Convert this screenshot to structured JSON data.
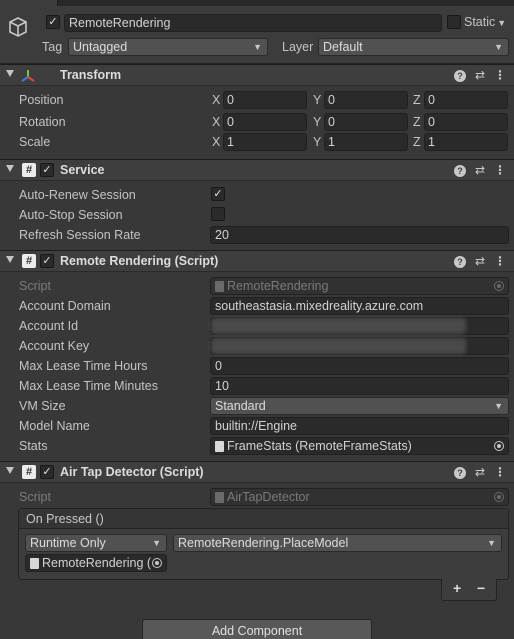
{
  "gameobject": {
    "name": "RemoteRendering",
    "static_label": "Static",
    "tag_label": "Tag",
    "tag_value": "Untagged",
    "layer_label": "Layer",
    "layer_value": "Default",
    "active": true
  },
  "transform": {
    "title": "Transform",
    "rows": [
      {
        "label": "Position",
        "x": "0",
        "y": "0",
        "z": "0"
      },
      {
        "label": "Rotation",
        "x": "0",
        "y": "0",
        "z": "0"
      },
      {
        "label": "Scale",
        "x": "1",
        "y": "1",
        "z": "1"
      }
    ],
    "axes": {
      "x": "X",
      "y": "Y",
      "z": "Z"
    }
  },
  "service": {
    "title": "Service",
    "auto_renew_label": "Auto-Renew Session",
    "auto_renew": true,
    "auto_stop_label": "Auto-Stop Session",
    "auto_stop": false,
    "refresh_label": "Refresh Session Rate",
    "refresh_value": "20"
  },
  "remote_rendering": {
    "title": "Remote Rendering (Script)",
    "script_label": "Script",
    "script_value": "RemoteRendering",
    "account_domain_label": "Account Domain",
    "account_domain_value": "southeastasia.mixedreality.azure.com",
    "account_id_label": "Account Id",
    "account_key_label": "Account Key",
    "max_lease_hours_label": "Max Lease Time Hours",
    "max_lease_hours_value": "0",
    "max_lease_minutes_label": "Max Lease Time Minutes",
    "max_lease_minutes_value": "10",
    "vm_size_label": "VM Size",
    "vm_size_value": "Standard",
    "model_name_label": "Model Name",
    "model_name_value": "builtin://Engine",
    "stats_label": "Stats",
    "stats_value": "FrameStats (RemoteFrameStats)"
  },
  "air_tap": {
    "title": "Air Tap Detector (Script)",
    "script_label": "Script",
    "script_value": "AirTapDetector",
    "event_header": "On Pressed ()",
    "runtime_value": "Runtime Only",
    "function_value": "RemoteRendering.PlaceModel",
    "target_value": "RemoteRendering (",
    "add_label": "+",
    "remove_label": "−"
  },
  "add_component_label": "Add Component",
  "colors": {
    "background": "#383838",
    "header": "#3e3e3e",
    "field": "#2a2a2a",
    "text": "#c4c4c4"
  }
}
